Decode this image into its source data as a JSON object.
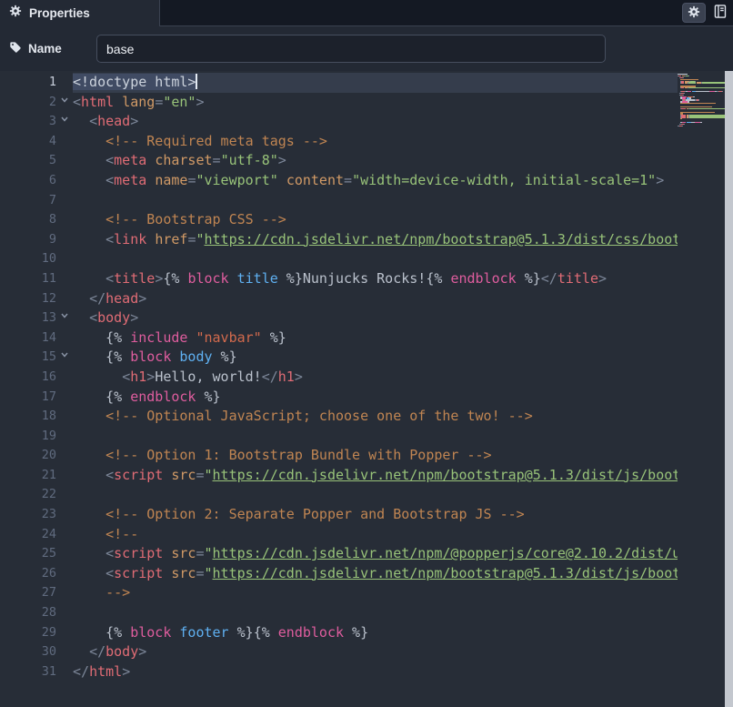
{
  "header": {
    "title": "Properties",
    "icons": [
      "gear-icon",
      "gear-icon",
      "book-icon"
    ]
  },
  "form": {
    "name": {
      "label": "Name",
      "value": "base",
      "icon": "tag-icon"
    }
  },
  "ui": {
    "panel_bg": "#232934",
    "header_bg": "#141923",
    "editor_bg": "#272d37",
    "active_line_bg": "#353d4c",
    "selection_bg": "#404b63",
    "scrollbar": "#c3c7ce"
  },
  "editor": {
    "active_line": 1,
    "colors": {
      "d": "#ccd3dd",
      "p": "#7c8698",
      "t": "#e06c75",
      "a": "#d19a66",
      "s": "#98c379",
      "u": "#98c379",
      "c": "#c08552",
      "k": "#df5d9e",
      "i": "#5fb0f1",
      "x": "#bac1cc",
      "q": "#d26a4d"
    },
    "lines": [
      {
        "n": 1,
        "cursor": true,
        "sel": true,
        "tokens": [
          [
            "<!doctype html>",
            "d"
          ]
        ]
      },
      {
        "n": 2,
        "fold": true,
        "tokens": [
          [
            "<",
            "p"
          ],
          [
            "html",
            "t"
          ],
          [
            " ",
            "x"
          ],
          [
            "lang",
            "a"
          ],
          [
            "=",
            "p"
          ],
          [
            "\"en\"",
            "s"
          ],
          [
            ">",
            "p"
          ]
        ]
      },
      {
        "n": 3,
        "fold": true,
        "tokens": [
          [
            "  ",
            "x"
          ],
          [
            "<",
            "p"
          ],
          [
            "head",
            "t"
          ],
          [
            ">",
            "p"
          ]
        ]
      },
      {
        "n": 4,
        "tokens": [
          [
            "    ",
            "x"
          ],
          [
            "<!-- Required meta tags -->",
            "c"
          ]
        ]
      },
      {
        "n": 5,
        "tokens": [
          [
            "    ",
            "x"
          ],
          [
            "<",
            "p"
          ],
          [
            "meta",
            "t"
          ],
          [
            " ",
            "x"
          ],
          [
            "charset",
            "a"
          ],
          [
            "=",
            "p"
          ],
          [
            "\"utf-8\"",
            "s"
          ],
          [
            ">",
            "p"
          ]
        ]
      },
      {
        "n": 6,
        "tokens": [
          [
            "    ",
            "x"
          ],
          [
            "<",
            "p"
          ],
          [
            "meta",
            "t"
          ],
          [
            " ",
            "x"
          ],
          [
            "name",
            "a"
          ],
          [
            "=",
            "p"
          ],
          [
            "\"viewport\"",
            "s"
          ],
          [
            " ",
            "x"
          ],
          [
            "content",
            "a"
          ],
          [
            "=",
            "p"
          ],
          [
            "\"width=device-width, initial-scale=1\"",
            "s"
          ],
          [
            ">",
            "p"
          ]
        ]
      },
      {
        "n": 7,
        "tokens": []
      },
      {
        "n": 8,
        "tokens": [
          [
            "    ",
            "x"
          ],
          [
            "<!-- Bootstrap CSS -->",
            "c"
          ]
        ]
      },
      {
        "n": 9,
        "tokens": [
          [
            "    ",
            "x"
          ],
          [
            "<",
            "p"
          ],
          [
            "link",
            "t"
          ],
          [
            " ",
            "x"
          ],
          [
            "href",
            "a"
          ],
          [
            "=",
            "p"
          ],
          [
            "\"",
            "s"
          ],
          [
            "https://cdn.jsdelivr.net/npm/bootstrap@5.1.3/dist/css/boot",
            "u"
          ]
        ]
      },
      {
        "n": 10,
        "tokens": []
      },
      {
        "n": 11,
        "tokens": [
          [
            "    ",
            "x"
          ],
          [
            "<",
            "p"
          ],
          [
            "title",
            "t"
          ],
          [
            ">",
            "p"
          ],
          [
            "{% ",
            "x"
          ],
          [
            "block",
            "k"
          ],
          [
            " ",
            "x"
          ],
          [
            "title",
            "i"
          ],
          [
            " %}",
            "x"
          ],
          [
            "Nunjucks Rocks!",
            "x"
          ],
          [
            "{% ",
            "x"
          ],
          [
            "endblock",
            "k"
          ],
          [
            " %}",
            "x"
          ],
          [
            "</",
            "p"
          ],
          [
            "title",
            "t"
          ],
          [
            ">",
            "p"
          ]
        ]
      },
      {
        "n": 12,
        "tokens": [
          [
            "  ",
            "x"
          ],
          [
            "</",
            "p"
          ],
          [
            "head",
            "t"
          ],
          [
            ">",
            "p"
          ]
        ]
      },
      {
        "n": 13,
        "fold": true,
        "tokens": [
          [
            "  ",
            "x"
          ],
          [
            "<",
            "p"
          ],
          [
            "body",
            "t"
          ],
          [
            ">",
            "p"
          ]
        ]
      },
      {
        "n": 14,
        "tokens": [
          [
            "    ",
            "x"
          ],
          [
            "{% ",
            "x"
          ],
          [
            "include",
            "k"
          ],
          [
            " ",
            "x"
          ],
          [
            "\"navbar\"",
            "q"
          ],
          [
            " %}",
            "x"
          ]
        ]
      },
      {
        "n": 15,
        "fold": true,
        "tokens": [
          [
            "    ",
            "x"
          ],
          [
            "{% ",
            "x"
          ],
          [
            "block",
            "k"
          ],
          [
            " ",
            "x"
          ],
          [
            "body",
            "i"
          ],
          [
            " %}",
            "x"
          ]
        ]
      },
      {
        "n": 16,
        "tokens": [
          [
            "      ",
            "x"
          ],
          [
            "<",
            "p"
          ],
          [
            "h1",
            "t"
          ],
          [
            ">",
            "p"
          ],
          [
            "Hello, world!",
            "x"
          ],
          [
            "</",
            "p"
          ],
          [
            "h1",
            "t"
          ],
          [
            ">",
            "p"
          ]
        ]
      },
      {
        "n": 17,
        "tokens": [
          [
            "    ",
            "x"
          ],
          [
            "{% ",
            "x"
          ],
          [
            "endblock",
            "k"
          ],
          [
            " %}",
            "x"
          ]
        ]
      },
      {
        "n": 18,
        "tokens": [
          [
            "    ",
            "x"
          ],
          [
            "<!-- Optional JavaScript; choose one of the two! -->",
            "c"
          ]
        ]
      },
      {
        "n": 19,
        "tokens": []
      },
      {
        "n": 20,
        "tokens": [
          [
            "    ",
            "x"
          ],
          [
            "<!-- Option 1: Bootstrap Bundle with Popper -->",
            "c"
          ]
        ]
      },
      {
        "n": 21,
        "tokens": [
          [
            "    ",
            "x"
          ],
          [
            "<",
            "p"
          ],
          [
            "script",
            "t"
          ],
          [
            " ",
            "x"
          ],
          [
            "src",
            "a"
          ],
          [
            "=",
            "p"
          ],
          [
            "\"",
            "s"
          ],
          [
            "https://cdn.jsdelivr.net/npm/bootstrap@5.1.3/dist/js/boot",
            "u"
          ]
        ]
      },
      {
        "n": 22,
        "tokens": []
      },
      {
        "n": 23,
        "tokens": [
          [
            "    ",
            "x"
          ],
          [
            "<!-- Option 2: Separate Popper and Bootstrap JS -->",
            "c"
          ]
        ]
      },
      {
        "n": 24,
        "tokens": [
          [
            "    ",
            "x"
          ],
          [
            "<!--",
            "c"
          ]
        ]
      },
      {
        "n": 25,
        "tokens": [
          [
            "    ",
            "x"
          ],
          [
            "<",
            "p"
          ],
          [
            "script",
            "t"
          ],
          [
            " ",
            "x"
          ],
          [
            "src",
            "a"
          ],
          [
            "=",
            "p"
          ],
          [
            "\"",
            "s"
          ],
          [
            "https://cdn.jsdelivr.net/npm/@popperjs/core@2.10.2/dist/u",
            "u"
          ]
        ]
      },
      {
        "n": 26,
        "tokens": [
          [
            "    ",
            "x"
          ],
          [
            "<",
            "p"
          ],
          [
            "script",
            "t"
          ],
          [
            " ",
            "x"
          ],
          [
            "src",
            "a"
          ],
          [
            "=",
            "p"
          ],
          [
            "\"",
            "s"
          ],
          [
            "https://cdn.jsdelivr.net/npm/bootstrap@5.1.3/dist/js/boot",
            "u"
          ]
        ]
      },
      {
        "n": 27,
        "tokens": [
          [
            "    ",
            "x"
          ],
          [
            "-->",
            "c"
          ]
        ]
      },
      {
        "n": 28,
        "tokens": []
      },
      {
        "n": 29,
        "tokens": [
          [
            "    ",
            "x"
          ],
          [
            "{% ",
            "x"
          ],
          [
            "block",
            "k"
          ],
          [
            " ",
            "x"
          ],
          [
            "footer",
            "i"
          ],
          [
            " %}",
            "x"
          ],
          [
            "{% ",
            "x"
          ],
          [
            "endblock",
            "k"
          ],
          [
            " %}",
            "x"
          ]
        ]
      },
      {
        "n": 30,
        "tokens": [
          [
            "  ",
            "x"
          ],
          [
            "</",
            "p"
          ],
          [
            "body",
            "t"
          ],
          [
            ">",
            "p"
          ]
        ]
      },
      {
        "n": 31,
        "tokens": [
          [
            "</",
            "p"
          ],
          [
            "html",
            "t"
          ],
          [
            ">",
            "p"
          ]
        ]
      }
    ]
  }
}
